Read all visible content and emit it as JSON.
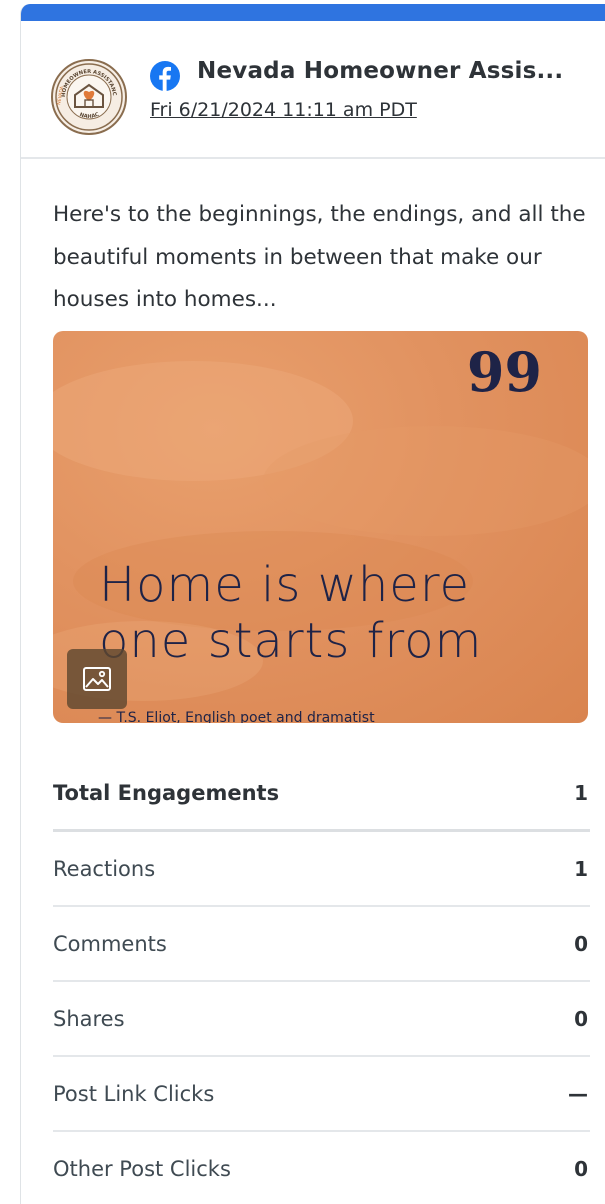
{
  "post": {
    "account_name": "Nevada Homeowner Assis...",
    "network_icon": "facebook-icon",
    "date": "Fri 6/21/2024 11:11 am PDT",
    "text": "Here's to the beginnings, the endings, and all the beautiful moments in between that make our houses into homes..."
  },
  "avatar": {
    "ring_text": "HOMEOWNER ASSISTANCE FUND",
    "bottom_text": "NAHAC",
    "side_text": "NEVADA"
  },
  "media": {
    "quote_mark": "99",
    "quote_line1": "Home is where",
    "quote_line2": "one starts from",
    "author": "— T.S. Eliot, English poet and dramatist",
    "badge_icon": "image-icon"
  },
  "metrics": [
    {
      "label": "Total Engagements",
      "value": "1"
    },
    {
      "label": "Reactions",
      "value": "1"
    },
    {
      "label": "Comments",
      "value": "0"
    },
    {
      "label": "Shares",
      "value": "0"
    },
    {
      "label": "Post Link Clicks",
      "value": "—"
    },
    {
      "label": "Other Post Clicks",
      "value": "0"
    }
  ],
  "colors": {
    "accent_bar": "#2f74e0",
    "facebook_blue": "#1877f2",
    "image_background": "#e19260",
    "quote_text": "#1e2347"
  }
}
